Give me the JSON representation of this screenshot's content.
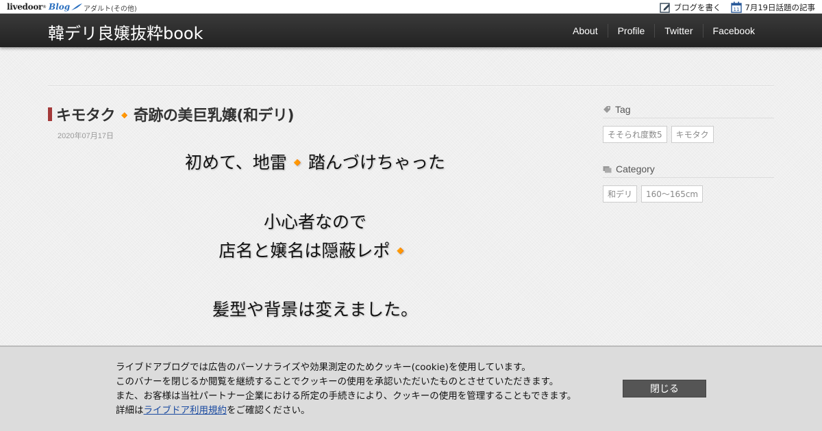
{
  "topbar": {
    "logo_main": "livedoor",
    "logo_sup": "®",
    "logo_blog": "Blog",
    "category": "アダルト(その他)",
    "write_blog": "ブログを書く",
    "calendar_day": "11",
    "trending": "7月19日話題の記事"
  },
  "header": {
    "site_title": "韓デリ良嬢抜粋book",
    "nav": [
      "About",
      "Profile",
      "Twitter",
      "Facebook"
    ]
  },
  "article": {
    "title": "キモタク🔸奇跡の美巨乳嬢(和デリ)",
    "date": "2020年07月17日",
    "lines": [
      "初めて、地雷🔸踏んづけちゃった",
      "小心者なので",
      "店名と嬢名は隠蔽レポ🔸",
      "髪型や背景は変えました。"
    ]
  },
  "sidebar": {
    "tag_heading": "Tag",
    "tags": [
      "そそられ度数5",
      "キモタク"
    ],
    "category_heading": "Category",
    "categories": [
      "和デリ",
      "160～165cm"
    ]
  },
  "cookie": {
    "line1": "ライブドアブログでは広告のパーソナライズや効果測定のためクッキー(cookie)を使用しています。",
    "line2": "このバナーを閉じるか閲覧を継続することでクッキーの使用を承認いただいたものとさせていただきます。",
    "line3": "また、お客様は当社パートナー企業における所定の手続きにより、クッキーの使用を管理することもできます。",
    "line4_prefix": "詳細は",
    "line4_link": "ライブドア利用規約",
    "line4_suffix": "をご確認ください。",
    "close_label": "閉じる"
  },
  "colors": {
    "header_bg": "#2c2c2c",
    "title_accent": "#a43a3a",
    "link": "#1a4aa0",
    "close_button": "#555555"
  }
}
